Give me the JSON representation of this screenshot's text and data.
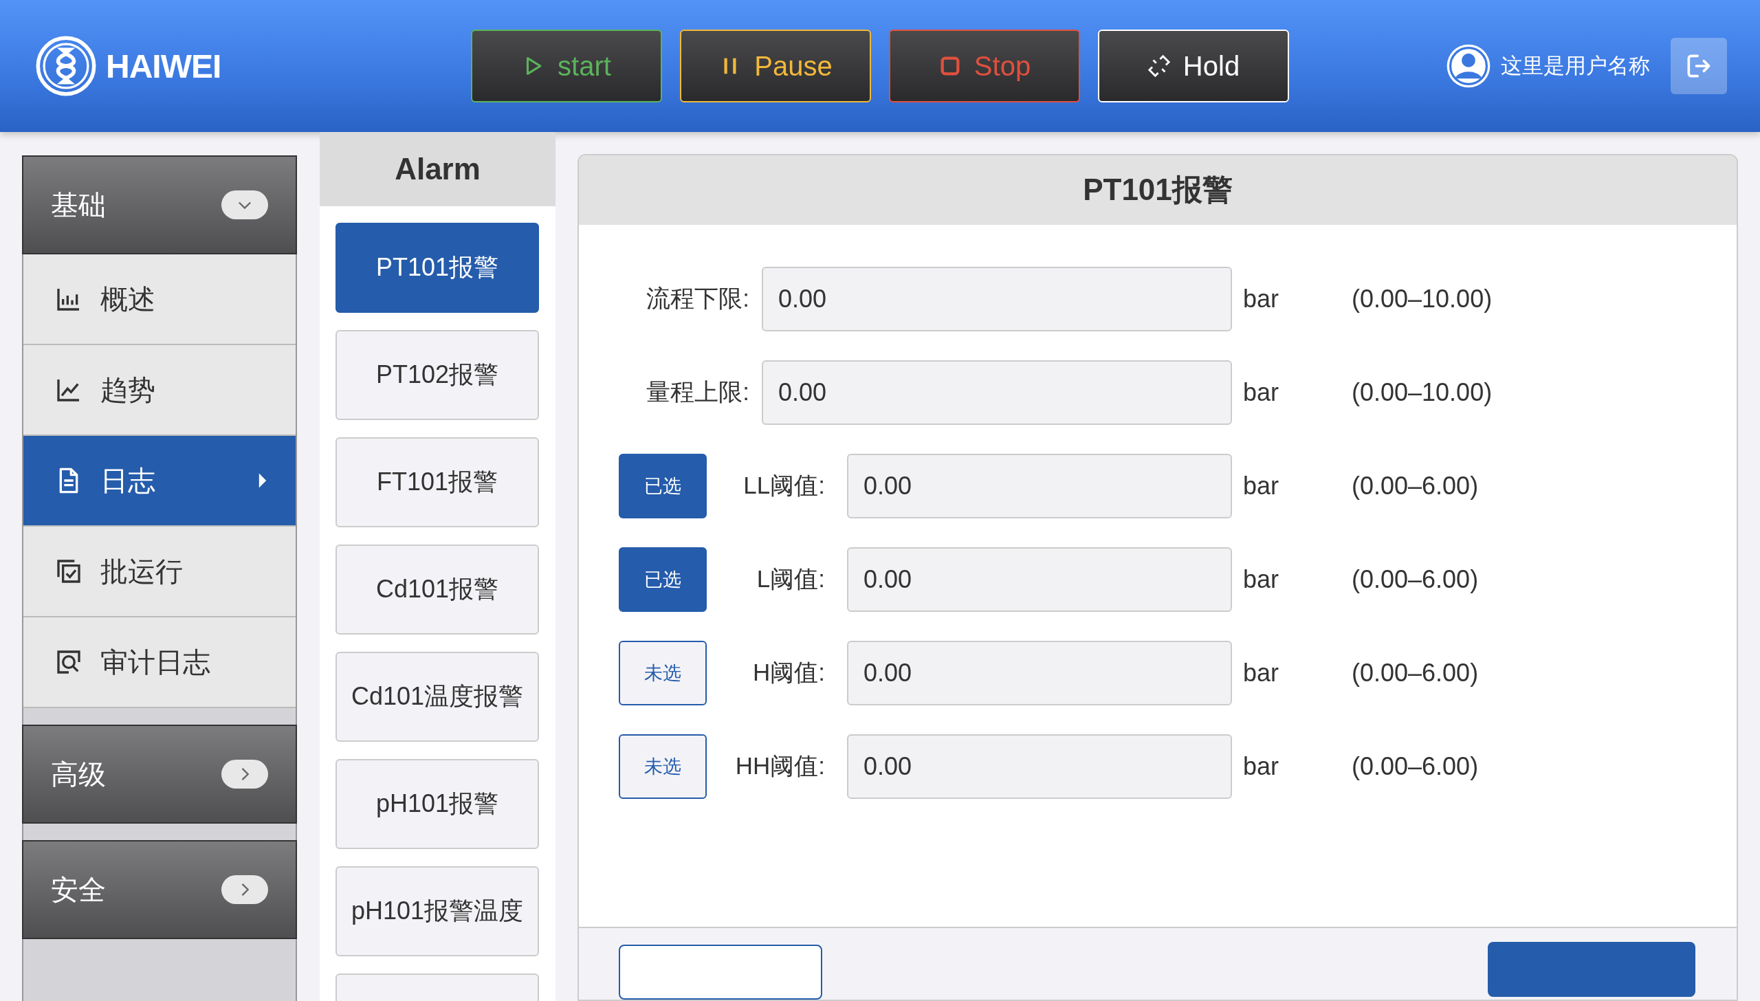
{
  "header": {
    "brand": "HAIWEI",
    "controls": [
      {
        "kind": "start",
        "label": "start"
      },
      {
        "kind": "pause",
        "label": "Pause"
      },
      {
        "kind": "stop",
        "label": "Stop"
      },
      {
        "kind": "hold",
        "label": "Hold"
      }
    ],
    "user": "这里是用户名称"
  },
  "sidebar": {
    "groups": [
      {
        "label": "基础",
        "expanded": true,
        "items": [
          {
            "label": "概述",
            "selected": false
          },
          {
            "label": "趋势",
            "selected": false
          },
          {
            "label": "日志",
            "selected": true
          },
          {
            "label": "批运行",
            "selected": false
          },
          {
            "label": "审计日志",
            "selected": false
          }
        ]
      },
      {
        "label": "高级",
        "expanded": false
      },
      {
        "label": "安全",
        "expanded": false
      }
    ]
  },
  "alarm_list": {
    "title": "Alarm",
    "items": [
      {
        "label": "PT101报警",
        "selected": true
      },
      {
        "label": "PT102报警",
        "selected": false
      },
      {
        "label": "FT101报警",
        "selected": false
      },
      {
        "label": "Cd101报警",
        "selected": false
      },
      {
        "label": "Cd101温度报警",
        "selected": false
      },
      {
        "label": "pH101报警",
        "selected": false
      },
      {
        "label": "pH101报警温度",
        "selected": false
      },
      {
        "selected": false
      }
    ]
  },
  "panel": {
    "title": "PT101报警",
    "rows": [
      {
        "kind": "limit",
        "label": "流程下限:",
        "value": "0.00",
        "unit": "bar",
        "range": "(0.00–10.00)"
      },
      {
        "kind": "limit",
        "label": "量程上限:",
        "value": "0.00",
        "unit": "bar",
        "range": "(0.00–10.00)"
      },
      {
        "kind": "threshold",
        "toggle": {
          "label": "已选",
          "selected": true
        },
        "label": "LL阈值:",
        "value": "0.00",
        "unit": "bar",
        "range": "(0.00–6.00)"
      },
      {
        "kind": "threshold",
        "toggle": {
          "label": "已选",
          "selected": true
        },
        "label": "L阈值:",
        "value": "0.00",
        "unit": "bar",
        "range": "(0.00–6.00)"
      },
      {
        "kind": "threshold",
        "toggle": {
          "label": "未选",
          "selected": false
        },
        "label": "H阈值:",
        "value": "0.00",
        "unit": "bar",
        "range": "(0.00–6.00)"
      },
      {
        "kind": "threshold",
        "toggle": {
          "label": "未选",
          "selected": false
        },
        "label": "HH阈值:",
        "value": "0.00",
        "unit": "bar",
        "range": "(0.00–6.00)"
      }
    ],
    "footer_buttons": [
      {
        "kind": "outline"
      },
      {
        "kind": "primary"
      }
    ]
  }
}
